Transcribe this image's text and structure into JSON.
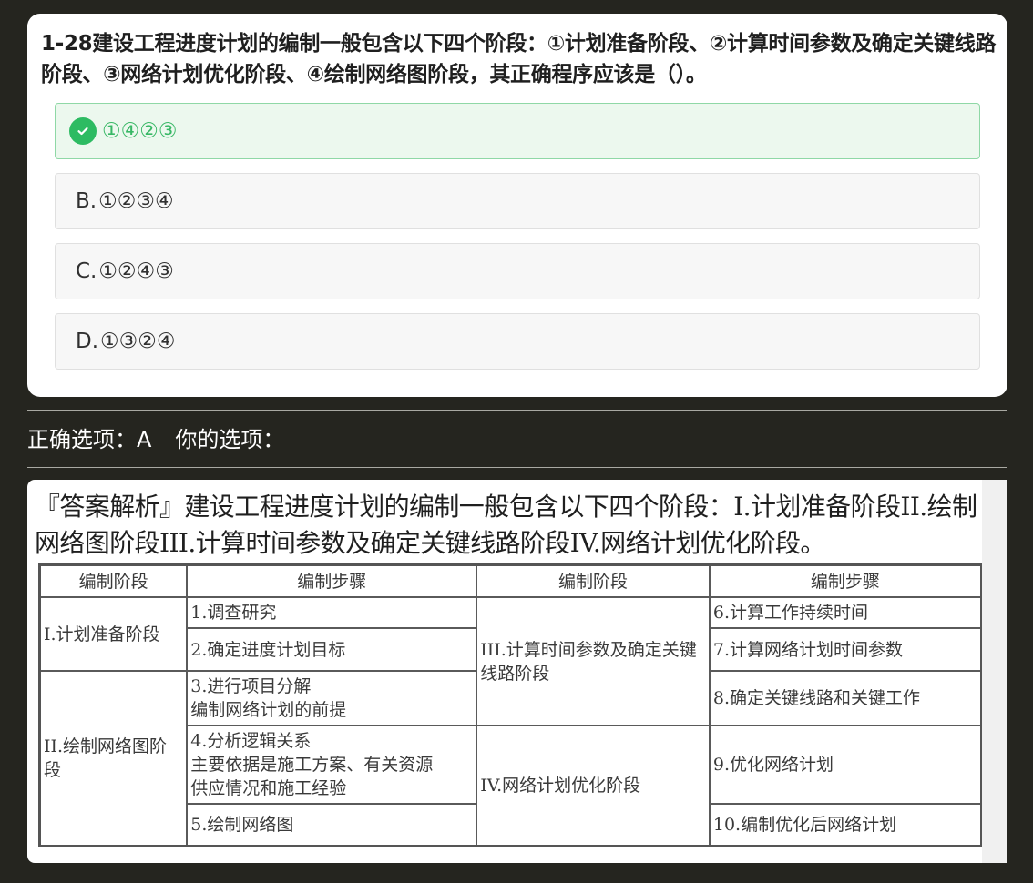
{
  "question": {
    "text": "1-28建设工程进度计划的编制一般包含以下四个阶段：①计划准备阶段、②计算时间参数及确定关键线路阶段、③网络计划优化阶段、④绘制网络图阶段，其正确程序应该是（）。",
    "options": [
      {
        "letter": "",
        "text": "①④②③",
        "correct": true
      },
      {
        "letter": "B.",
        "text": "①②③④",
        "correct": false
      },
      {
        "letter": "C.",
        "text": "①②④③",
        "correct": false
      },
      {
        "letter": "D.",
        "text": "①③②④",
        "correct": false
      }
    ]
  },
  "answer": {
    "correct_label": "正确选项：",
    "correct_value": "A",
    "yours_label": "你的选项：",
    "yours_value": ""
  },
  "analysis": {
    "text": "『答案解析』建设工程进度计划的编制一般包含以下四个阶段：I.计划准备阶段II.绘制网络图阶段III.计算时间参数及确定关键线路阶段IV.网络计划优化阶段。",
    "table": {
      "headers": [
        "编制阶段",
        "编制步骤",
        "编制阶段",
        "编制步骤"
      ],
      "stages": [
        "I.计划准备阶段",
        "II.绘制网络图阶段",
        "III.计算时间参数及确定关键线路阶段",
        "IV.网络计划优化阶段"
      ],
      "steps": [
        "1.调查研究",
        "2.确定进度计划目标",
        "3.进行项目分解",
        "编制网络计划的前提",
        "4.分析逻辑关系",
        "主要依据是施工方案、有关资源",
        "供应情况和施工经验",
        "5.绘制网络图",
        "6.计算工作持续时间",
        "7.计算网络计划时间参数",
        "8.确定关键线路和关键工作",
        "9.优化网络计划",
        "10.编制优化后网络计划"
      ]
    }
  }
}
